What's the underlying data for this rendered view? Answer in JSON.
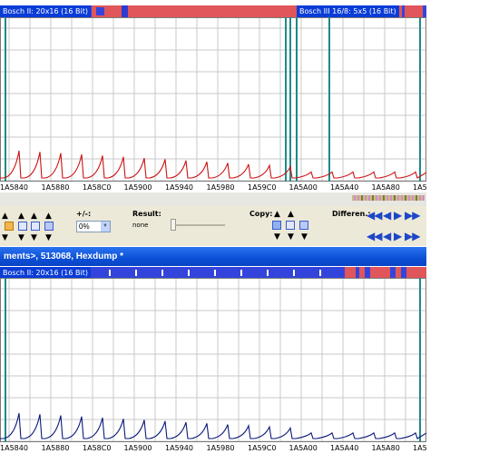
{
  "top_panel": {
    "map_label_1": "Bosch II: 20x16 (16 Bit)",
    "map_label_2": "Bosch III 16/8: 5x5 (16 Bit)",
    "x_ticks": [
      "1A5840",
      "1A5880",
      "1A58C0",
      "1A5900",
      "1A5940",
      "1A5980",
      "1A59C0",
      "1A5A00",
      "1A5A40",
      "1A5A80",
      "1A5"
    ]
  },
  "bottom_panel": {
    "map_label_1": "Bosch II: 20x16 (16 Bit)",
    "x_ticks": [
      "1A5840",
      "1A5880",
      "1A58C0",
      "1A5900",
      "1A5940",
      "1A5980",
      "1A59C0",
      "1A5A00",
      "1A5A40",
      "1A5A80",
      "1A5"
    ]
  },
  "toolbar": {
    "plusminus_label": "+/-:",
    "plusminus_value": "0%",
    "result_label": "Result:",
    "result_value": "none",
    "copy_label": "Copy:",
    "differences_label": "Differen.:"
  },
  "window": {
    "title": "ments>, 513068, Hexdump *"
  },
  "icons": {
    "up": "▲",
    "down": "▼",
    "left": "◀",
    "right": "▶",
    "double_left": "◀◀",
    "double_right": "▶▶"
  },
  "colors": {
    "top_trace": "#cc1111",
    "bottom_trace": "#0a1a7a",
    "map_strip_red": "#e0565a",
    "map_strip_blue": "#3344dd",
    "marker_teal": "#1f8a88",
    "title_bar": "#0b4fd6"
  }
}
